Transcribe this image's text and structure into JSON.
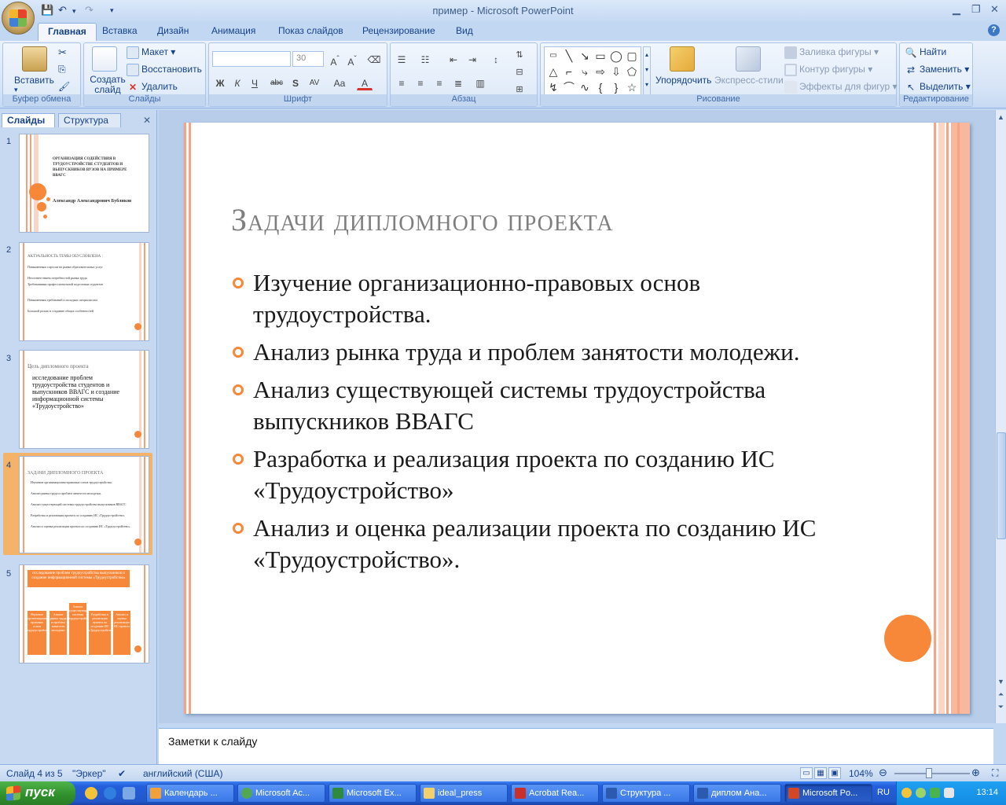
{
  "window": {
    "title": "пример - Microsoft PowerPoint"
  },
  "tabs": [
    "Главная",
    "Вставка",
    "Дизайн",
    "Анимация",
    "Показ слайдов",
    "Рецензирование",
    "Вид"
  ],
  "ribbon": {
    "clipboard": {
      "label": "Буфер обмена",
      "paste": "Вставить"
    },
    "slides": {
      "label": "Слайды",
      "new_slide": "Создать слайд",
      "layout": "Макет",
      "reset": "Восстановить",
      "delete": "Удалить"
    },
    "font": {
      "label": "Шрифт",
      "font_name": "",
      "font_size": "30"
    },
    "paragraph": {
      "label": "Абзац"
    },
    "drawing": {
      "label": "Рисование",
      "arrange": "Упорядочить",
      "quick_styles": "Экспресс-стили",
      "fill": "Заливка фигуры",
      "outline": "Контур фигуры",
      "effects": "Эффекты для фигур"
    },
    "editing": {
      "label": "Редактирование",
      "find": "Найти",
      "replace": "Заменить",
      "select": "Выделить"
    }
  },
  "left_panel": {
    "tabs": [
      "Слайды",
      "Структура"
    ],
    "selected_slide": 4,
    "thumbnails": [
      {
        "num": "1",
        "title": "ОРГАНИЗАЦИЯ СОДЕЙСТВИЯ В ТРУДОУСТРОЙСТВЕ СТУДЕНТОВ И ВЫПУСКНИКОВ ВУЗОВ НА ПРИМЕРЕ ВВАГС",
        "author": "Александр Александрович Бубликов"
      },
      {
        "num": "2",
        "title": "Актуальность темы обусловлена :",
        "items": [
          "Повышенным спросом на рынке образовательных услуг",
          "Несоответствием потребностей рынка труда",
          "Требованиями профессиональной подготовки студентов",
          "Повышенным требований к молодым специалистам",
          "Большой ролью в созданию общих особенностей"
        ]
      },
      {
        "num": "3",
        "title": "Цель дипломного проекта",
        "body": "исследование проблем трудоустройства студентов и выпускников ВВАГС и создание информационной системы «Трудоустройство»"
      },
      {
        "num": "4",
        "title": "Задачи дипломного проекта",
        "items": [
          "Изучение организационно-правовых основ трудоустройства.",
          "Анализ рынка труда и проблем занятости молодежи.",
          "Анализ существующей системы трудоустройства выпускников ВВАГС",
          "Разработка и реализация проекта по созданию ИС «Трудоустройство»",
          "Анализ и оценка реализации проекта по созданию ИС «Трудоустройство»."
        ]
      },
      {
        "num": "5",
        "header": "исследование проблем трудоустройства выпускников и создание информационной системы «Трудоустройство»",
        "boxes": [
          "Изучение организационно-правовых основ трудоустройства",
          "Анализ рынка труда и проблем занятости молодежи",
          "Анализ существующей системы трудоустройства",
          "Разработка и реализация проекта по созданию ИС «Трудоустройство»",
          "Анализ и оценка реализации ИС проекта"
        ]
      }
    ]
  },
  "slide": {
    "title": "Задачи дипломного проекта",
    "bullets": [
      "Изучение организационно-правовых основ трудоустройства.",
      "Анализ рынка труда и проблем занятости молодежи.",
      "Анализ существующей системы трудоустройства выпускников ВВАГС",
      "Разработка и реализация проекта по созданию ИС «Трудоустройство»",
      "Анализ и оценка реализации проекта по созданию ИС «Трудоустройство»."
    ]
  },
  "notes": {
    "placeholder": "Заметки к слайду"
  },
  "status": {
    "slide_info": "Слайд 4 из 5",
    "theme": "\"Эркер\"",
    "language": "английский (США)",
    "zoom": "104%"
  },
  "taskbar": {
    "start": "пуск",
    "tasks": [
      "Календарь ...",
      "Microsoft Ac...",
      "Microsoft Ex...",
      "ideal_press",
      "Acrobat Rea...",
      "Структура ...",
      "диплом Ана...",
      "Microsoft Po..."
    ],
    "lang": "RU",
    "clock": "13:14"
  },
  "colors": {
    "accent": "#f7883a",
    "stripe": "#f6a483",
    "ribbon": "#dde9f8"
  }
}
